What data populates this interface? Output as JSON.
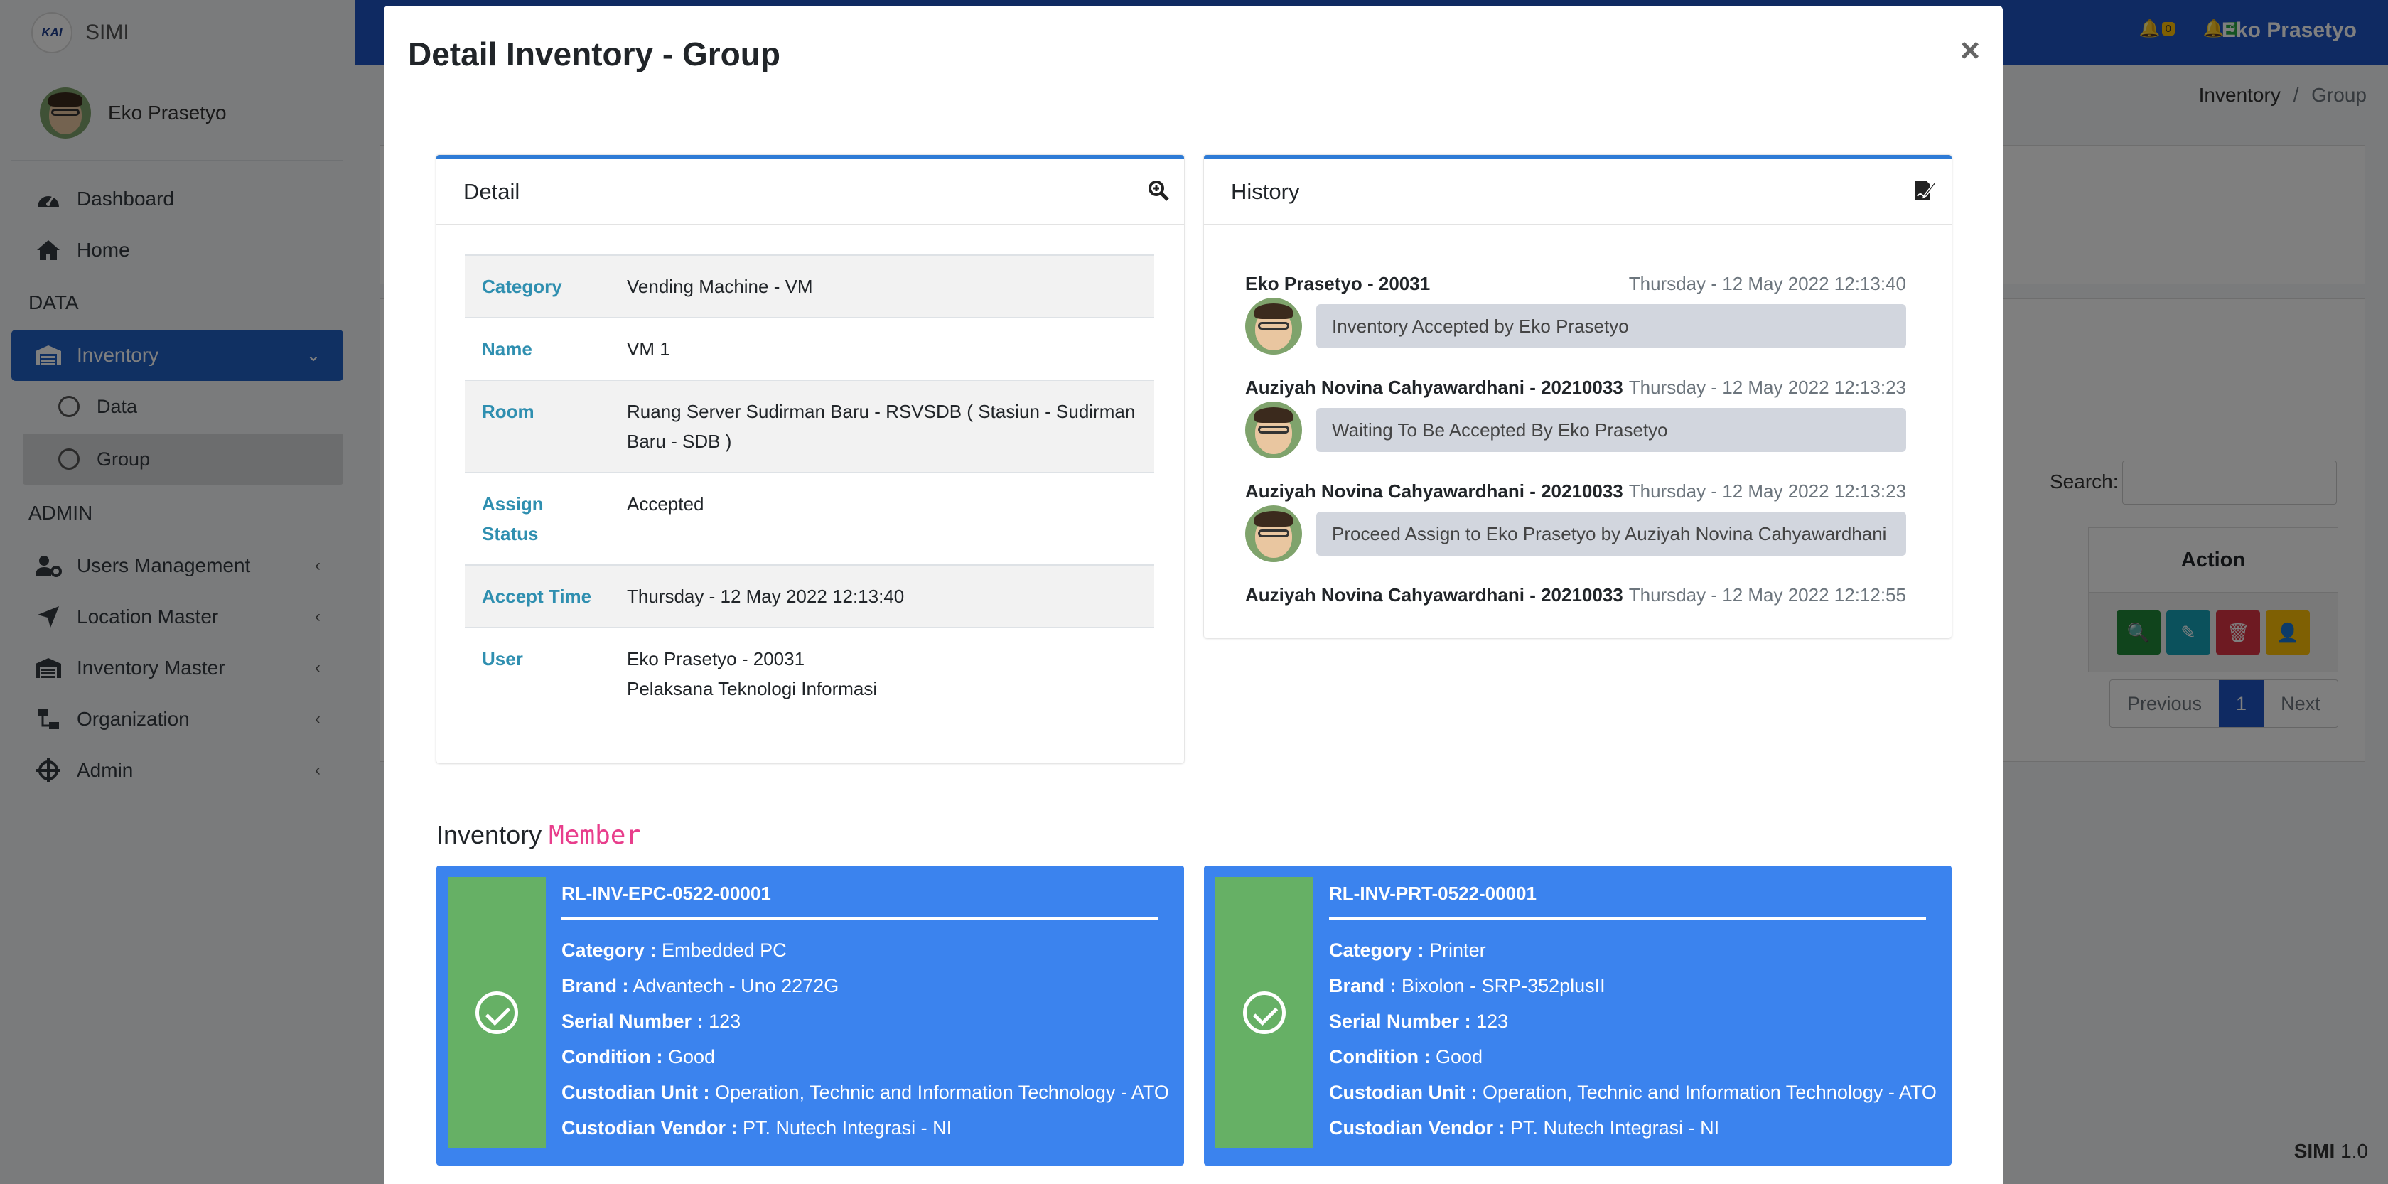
{
  "app": {
    "brand_logo": "KAI",
    "brand_name": "SIMI",
    "user_name": "Eko Prasetyo",
    "version_label": "SIMI",
    "version_number": "1.0"
  },
  "sidebar": {
    "items": [
      {
        "label": "Dashboard",
        "icon": "tachometer-icon"
      },
      {
        "label": "Home",
        "icon": "home-icon"
      }
    ],
    "header_data": "DATA",
    "inventory_label": "Inventory",
    "inventory_sub": [
      "Data",
      "Group"
    ],
    "header_admin": "ADMIN",
    "admin_items": [
      {
        "label": "Users Management",
        "icon": "users-cog-icon"
      },
      {
        "label": "Location Master",
        "icon": "location-arrow-icon"
      },
      {
        "label": "Inventory Master",
        "icon": "warehouse-icon"
      },
      {
        "label": "Organization",
        "icon": "sitemap-icon"
      },
      {
        "label": "Admin",
        "icon": "crosshair-icon"
      }
    ]
  },
  "topbar": {
    "notif_count_1": "0",
    "notif_count_2": "0",
    "user": "Eko Prasetyo"
  },
  "breadcrumb": {
    "parent": "Inventory",
    "separator": "/",
    "current": "Group"
  },
  "table": {
    "search_label": "Search:",
    "action_header": "Action"
  },
  "pagination": {
    "previous": "Previous",
    "page": "1",
    "next": "Next"
  },
  "modal": {
    "title": "Detail Inventory - Group",
    "close": "×",
    "detail": {
      "title": "Detail",
      "rows": [
        {
          "key": "Category",
          "value": "Vending Machine - VM"
        },
        {
          "key": "Name",
          "value": "VM 1"
        },
        {
          "key": "Room",
          "value": "Ruang Server Sudirman Baru - RSVSDB ( Stasiun - Sudirman Baru - SDB )"
        },
        {
          "key": "Assign Status",
          "value": "Accepted"
        },
        {
          "key": "Accept Time",
          "value": "Thursday - 12 May 2022 12:13:40"
        },
        {
          "key": "User",
          "value": "Eko Prasetyo - 20031",
          "value2": "Pelaksana Teknologi Informasi"
        }
      ]
    },
    "history": {
      "title": "History",
      "entries": [
        {
          "name": "Eko Prasetyo - 20031",
          "time": "Thursday - 12 May 2022 12:13:40",
          "message": "Inventory Accepted by Eko Prasetyo"
        },
        {
          "name": "Auziyah Novina Cahyawardhani - 20210033",
          "time": "Thursday - 12 May 2022 12:13:23",
          "message": "Waiting To Be Accepted By Eko Prasetyo"
        },
        {
          "name": "Auziyah Novina Cahyawardhani - 20210033",
          "time": "Thursday - 12 May 2022 12:13:23",
          "message": "Proceed Assign to Eko Prasetyo by Auziyah Novina Cahyawardhani"
        },
        {
          "name": "Auziyah Novina Cahyawardhani - 20210033",
          "time": "Thursday - 12 May 2022 12:12:55"
        }
      ]
    },
    "member": {
      "title_main": "Inventory",
      "title_accent": "Member",
      "field_labels": {
        "category": "Category :",
        "brand": "Brand :",
        "serial": "Serial Number :",
        "condition": "Condition :",
        "unit": "Custodian Unit :",
        "vendor": "Custodian Vendor :"
      },
      "items": [
        {
          "code": "RL-INV-EPC-0522-00001",
          "category": "Embedded PC",
          "brand": "Advantech - Uno 2272G",
          "serial": "123",
          "condition": "Good",
          "unit": "Operation, Technic and Information Technology - ATO",
          "vendor": "PT. Nutech Integrasi - NI"
        },
        {
          "code": "RL-INV-PRT-0522-00001",
          "category": "Printer",
          "brand": "Bixolon - SRP-352plusII",
          "serial": "123",
          "condition": "Good",
          "unit": "Operation, Technic and Information Technology - ATO",
          "vendor": "PT. Nutech Integrasi - NI"
        }
      ]
    }
  },
  "colors": {
    "primary": "#1f54c4",
    "card_blue": "#3b83ee",
    "card_green": "#66b065",
    "label_teal": "#2f8fb0",
    "accent_pink": "#e83e8c"
  }
}
